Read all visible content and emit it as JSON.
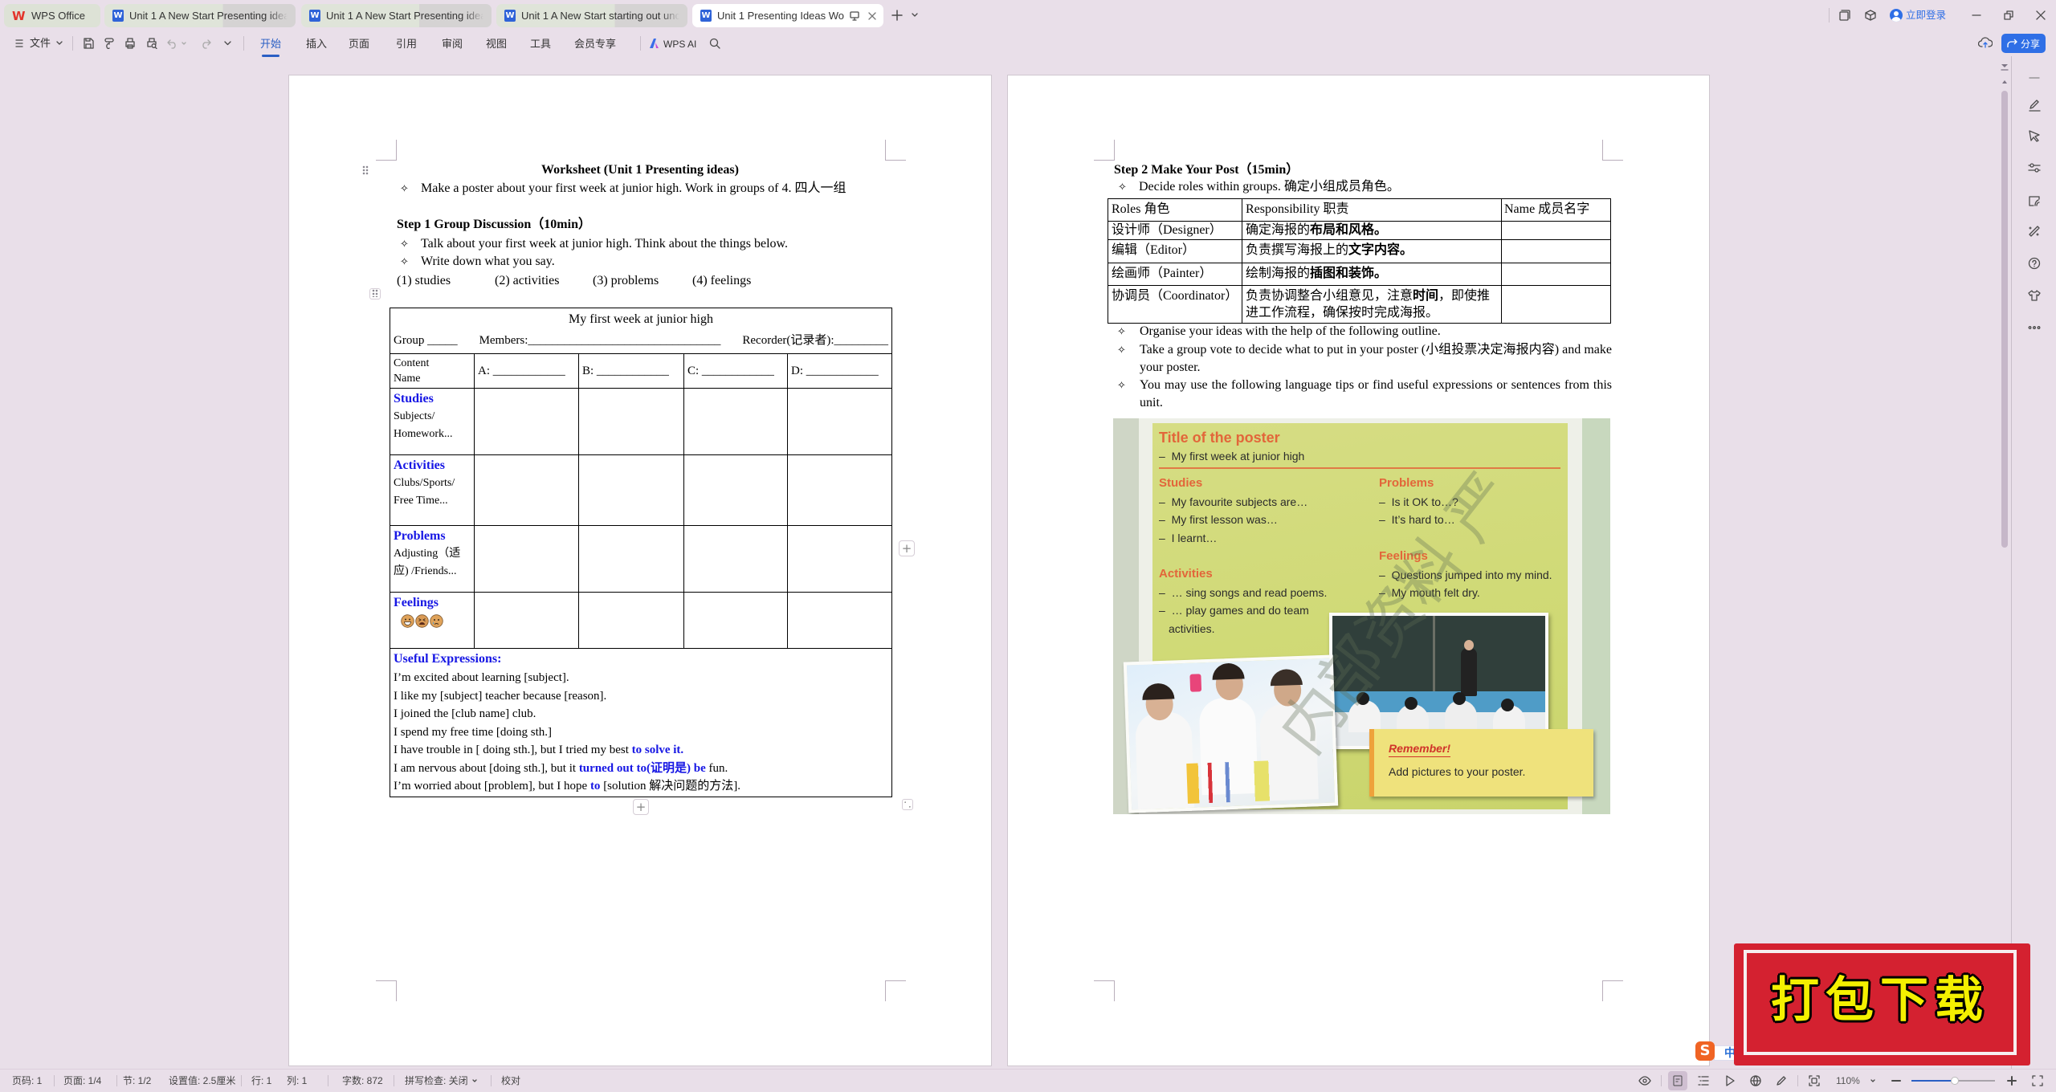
{
  "window": {
    "tabs": [
      {
        "label": "WPS Office"
      },
      {
        "label": "Unit 1 A New Start Presenting idea"
      },
      {
        "label": "Unit 1 A New Start Presenting idea"
      },
      {
        "label": "Unit 1 A New Start starting out unc"
      },
      {
        "label": "Unit 1 Presenting Ideas Wo"
      }
    ],
    "active_tab": 4,
    "login_label": "立即登录",
    "share_label": "分享"
  },
  "toolbar": {
    "file_label": "文件",
    "menus": [
      "开始",
      "插入",
      "页面",
      "引用",
      "审阅",
      "视图",
      "工具",
      "会员专享"
    ],
    "active_menu": "开始",
    "ai_label": "WPS AI"
  },
  "page1": {
    "title": "Worksheet (Unit 1 Presenting ideas)",
    "intro": "Make a poster about your first week at junior high. Work in groups of 4.  四人一组",
    "step1_heading": "Step 1 Group Discussion（10min）",
    "step1_bullets": [
      "Talk about your first week at junior high. Think about the things below.",
      "Write down what you say."
    ],
    "topics": [
      "(1)  studies",
      "(2) activities",
      "(3) problems",
      "(4) feelings"
    ],
    "table": {
      "title": "My first week at junior high",
      "group": "Group _____",
      "members": "Members:________________________________",
      "recorder": "Recorder(记录者):_________",
      "header_label": [
        "Content",
        "Name"
      ],
      "columns": [
        "A: ____________",
        "B: ____________",
        "C: ____________",
        "D: ____________"
      ],
      "rows": [
        {
          "title": "Studies",
          "lines": [
            "Subjects/",
            "Homework..."
          ]
        },
        {
          "title": "Activities",
          "lines": [
            "Clubs/Sports/",
            "Free Time..."
          ]
        },
        {
          "title": "Problems",
          "lines": [
            "Adjusting（适",
            "应) /Friends..."
          ]
        },
        {
          "title": "Feelings",
          "icons": [
            "grinning-face",
            "tired-face",
            "crying-face"
          ]
        }
      ],
      "useful_title": "Useful Expressions:",
      "expressions": [
        [
          {
            "text": "I’m excited about learning [subject]."
          }
        ],
        [
          {
            "text": "I like my [subject] teacher because [reason]."
          }
        ],
        [
          {
            "text": "I joined the [club name] club."
          }
        ],
        [
          {
            "text": "I spend my free time [doing sth.]"
          }
        ],
        [
          {
            "text": "I have trouble in [ doing sth.], but I tried my best "
          },
          {
            "text": "to solve it.",
            "em": true
          }
        ],
        [
          {
            "text": "I am nervous about [doing sth.], but it "
          },
          {
            "text": "turned out to(证明是) be",
            "em": true
          },
          {
            "text": " fun."
          }
        ],
        [
          {
            "text": "I’m worried about [problem], but I hope "
          },
          {
            "text": "to",
            "em": true
          },
          {
            "text": " [solution 解决问题的方法]."
          }
        ]
      ]
    }
  },
  "page2": {
    "step2_heading": "Step 2 Make Your Post（15min）",
    "roles_bullet": "Decide roles within groups.  确定小组成员角色。",
    "roles_table": {
      "headers": [
        "Roles 角色",
        "Responsibility 职责",
        "Name 成员名字"
      ],
      "rows": [
        {
          "role": "设计师（Designer）",
          "resp": [
            {
              "text": "确定海报的"
            },
            {
              "text": "布局和风格。",
              "bold": true
            }
          ],
          "name": ""
        },
        {
          "role": "编辑（Editor）",
          "resp": [
            {
              "text": "负责撰写海报上的"
            },
            {
              "text": "文字内容。",
              "bold": true
            }
          ],
          "name": ""
        },
        {
          "role": "绘画师（Painter）",
          "resp": [
            {
              "text": "绘制海报的"
            },
            {
              "text": "插图和装饰。",
              "bold": true
            }
          ],
          "name": ""
        },
        {
          "role": "协调员（Coordinator）",
          "resp": [
            {
              "text": "负责协调整合小组意见，注意"
            },
            {
              "text": "时间",
              "bold": true
            },
            {
              "text": "，即使推进工作流程，确保按时完成海报。"
            }
          ],
          "name": ""
        }
      ]
    },
    "bullets": [
      "Organise your ideas with the help of the following outline.",
      "Take a group vote to decide what to put in your poster (小组投票决定海报内容) and make your poster.",
      "You may use the following language tips or find useful expressions or sentences from this unit."
    ],
    "poster": {
      "title_heading": "Title of the poster",
      "title_item": "My first week at junior high",
      "sections": {
        "studies": {
          "heading": "Studies",
          "items": [
            "My favourite subjects are…",
            "My first lesson was…",
            "I learnt…"
          ]
        },
        "activities": {
          "heading": "Activities",
          "items": [
            "… sing songs and read poems.",
            "… play games and do team activities."
          ]
        },
        "problems": {
          "heading": "Problems",
          "items": [
            "Is it OK to…?",
            "It’s hard to…"
          ]
        },
        "feelings": {
          "heading": "Feelings",
          "items": [
            "Questions jumped into my mind.",
            "My mouth felt dry."
          ]
        }
      },
      "remember_title": "Remember!",
      "remember_text": "Add pictures to your poster.",
      "watermark": "内部资料 严"
    }
  },
  "statusbar": {
    "items": [
      "页码: 1",
      "页面: 1/4",
      "节: 1/2",
      "设置值: 2.5厘米",
      "行: 1",
      "列: 1",
      "字数: 872",
      "拼写检查: 关闭",
      "校对"
    ],
    "zoom_label": "110%",
    "zoom_slider_fraction": 0.52
  },
  "overlay": {
    "stamp_text": "打包下载",
    "ime_mode": "中"
  },
  "colors": {
    "accent": "#2f6fe6",
    "doc_emphasis": "#1616e4",
    "poster_heading": "#e2663a",
    "stamp_red": "#d42130",
    "stamp_text": "#f4f000"
  }
}
